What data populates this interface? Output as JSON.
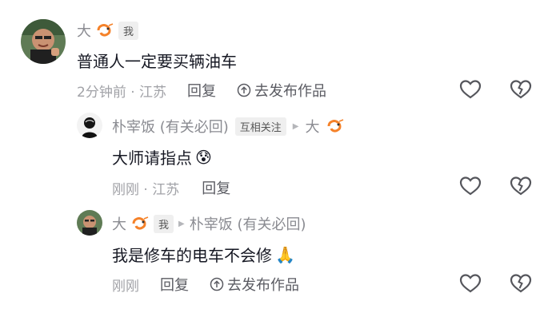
{
  "comments": [
    {
      "author": "大",
      "author_badge": "我",
      "text": "普通人一定要买辆油车",
      "meta": "2分钟前 · 江苏",
      "reply_label": "回复",
      "publish_label": "去发布作品"
    }
  ],
  "replies": [
    {
      "author": "朴宰饭 (有关必回)",
      "relation_badge": "互相关注",
      "target": "大",
      "text": "大师请指点",
      "emoji": "😰",
      "meta": "刚刚 · 江苏",
      "reply_label": "回复"
    },
    {
      "author": "大",
      "author_badge": "我",
      "target": "朴宰饭 (有关必回)",
      "text": "我是修车的电车不会修",
      "emoji": "🙏",
      "meta": "刚刚",
      "reply_label": "回复",
      "publish_label": "去发布作品"
    }
  ],
  "icons": {
    "like": "heart-outline-icon",
    "dislike": "broken-heart-icon",
    "publish": "upload-circle-icon",
    "arrow": "right-triangle-icon"
  },
  "colors": {
    "primary_text": "#161823",
    "secondary_text": "#8a8b91",
    "meta_text": "#a1a2a7",
    "badge_bg": "#efefef",
    "emoji_orange": "#f5822a"
  }
}
